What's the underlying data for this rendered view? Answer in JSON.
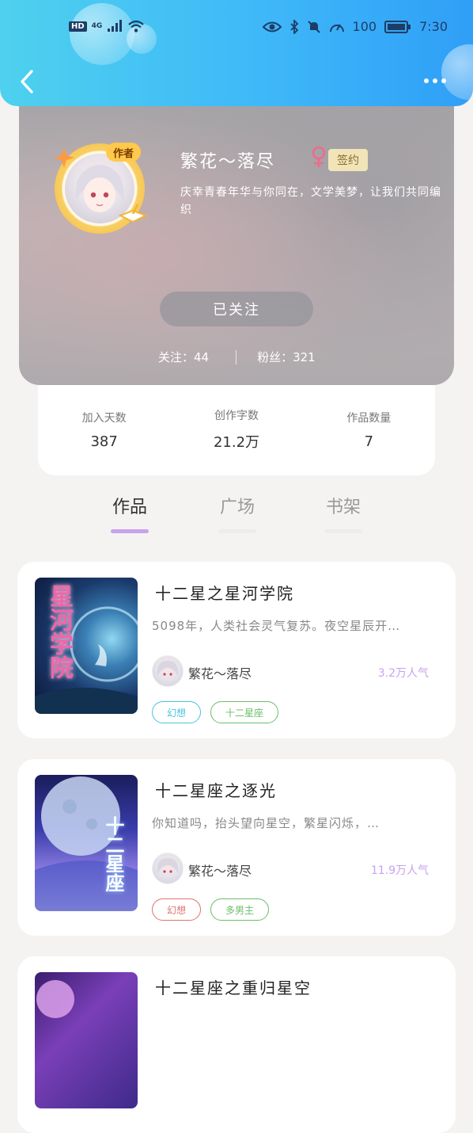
{
  "status_bar": {
    "hd": "HD",
    "network": "4G",
    "battery": "100",
    "time": "7:30"
  },
  "profile": {
    "author_tag": "作者",
    "name": "繁花～落尽",
    "signed_label": "签约",
    "bio": "庆幸青春年华与你同在，文学美梦，让我们共同编织",
    "follow_label": "已关注",
    "following_label": "关注：44",
    "fans_label": "粉丝：321"
  },
  "stats": [
    {
      "label": "加入天数",
      "value": "387"
    },
    {
      "label": "创作字数",
      "value": "21.2万"
    },
    {
      "label": "作品数量",
      "value": "7"
    }
  ],
  "tabs": [
    {
      "label": "作品",
      "active": true
    },
    {
      "label": "广场",
      "active": false
    },
    {
      "label": "书架",
      "active": false
    }
  ],
  "books": [
    {
      "title": "十二星之星河学院",
      "desc": "5098年，人类社会灵气复苏。夜空星辰开…",
      "author": "繁花～落尽",
      "popularity": "3.2万人气",
      "cover_text": "星河学院",
      "tags": [
        {
          "label": "幻想",
          "color": "#4cc3dc"
        },
        {
          "label": "十二星座",
          "color": "#6cbf6a"
        }
      ]
    },
    {
      "title": "十二星座之逐光",
      "desc": "你知道吗，抬头望向星空，繁星闪烁，…",
      "author": "繁花～落尽",
      "popularity": "11.9万人气",
      "cover_text": "十二星座",
      "tags": [
        {
          "label": "幻想",
          "color": "#e07470"
        },
        {
          "label": "多男主",
          "color": "#6cbf6a"
        }
      ]
    },
    {
      "title": "十二星座之重归星空",
      "desc": "",
      "author": "",
      "popularity": "",
      "cover_text": "",
      "tags": []
    }
  ],
  "colors": {
    "header_start": "#4ed1ee",
    "header_end": "#2f9ff7",
    "tab_accent": "#c8a2ee",
    "popularity": "#c7a3ee",
    "gender_female": "#ef6b8a"
  }
}
